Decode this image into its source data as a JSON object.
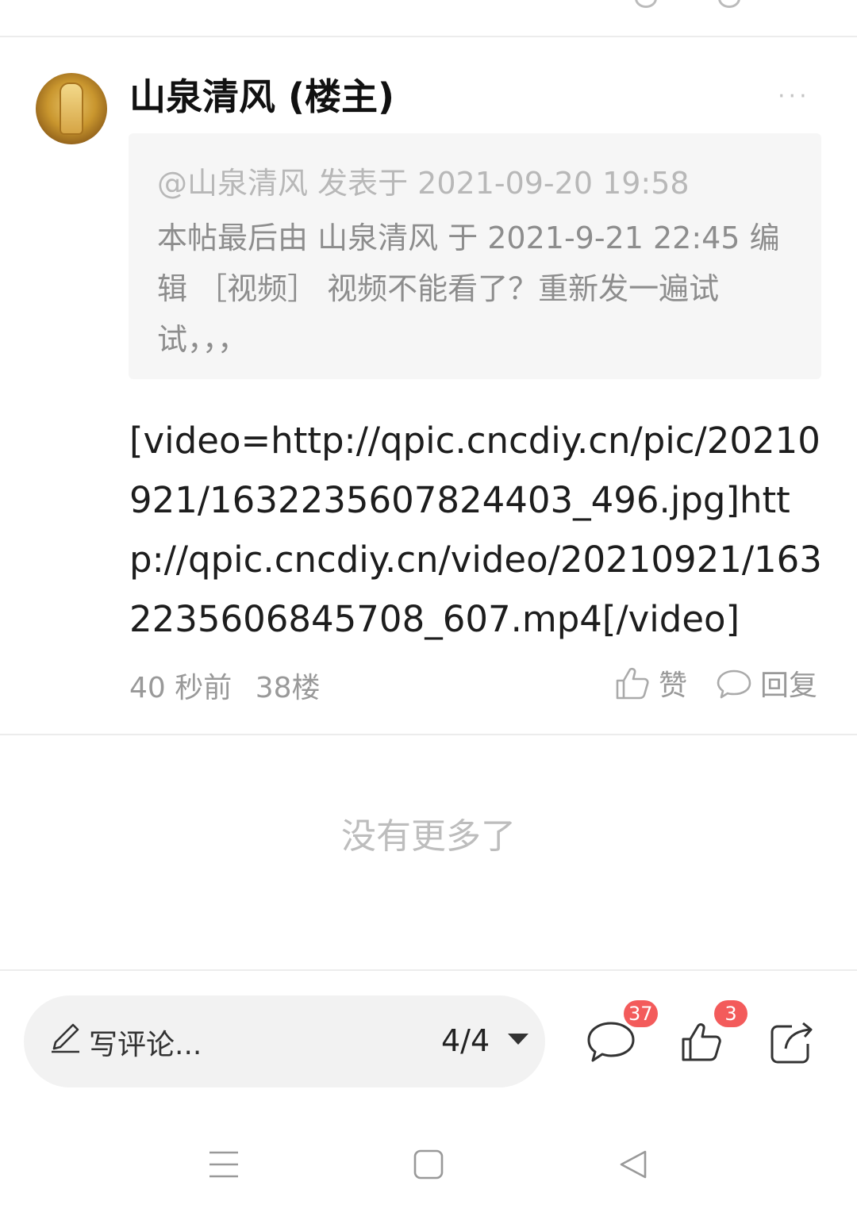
{
  "post": {
    "author": "山泉清风 (楼主)",
    "more_label": "···",
    "quote_header": "@山泉清风 发表于 2021-09-20 19:58",
    "quote_body": "本帖最后由 山泉清风 于 2021-9-21 22:45 编辑 ［视频］ 视频不能看了？重新发一遍试试，，，",
    "content": "[video=http://qpic.cncdiy.cn/pic/20210921/1632235607824403_496.jpg]http://qpic.cncdiy.cn/video/20210921/1632235606845708_607.mp4[/video]",
    "time": "40 秒前",
    "floor": "38楼",
    "like_label": "赞",
    "reply_label": "回复"
  },
  "footer_note": "没有更多了",
  "bottom_bar": {
    "comment_placeholder": "写评论...",
    "page_indicator": "4/4",
    "comment_count": "37",
    "like_count": "3"
  },
  "icons": {
    "pen": "pencil-icon",
    "comment": "comment-bubble-icon",
    "like": "thumbs-up-icon",
    "share": "share-icon"
  },
  "colors": {
    "badge": "#f35b5b",
    "muted_text": "#999999",
    "quote_bg": "#f6f6f6"
  }
}
